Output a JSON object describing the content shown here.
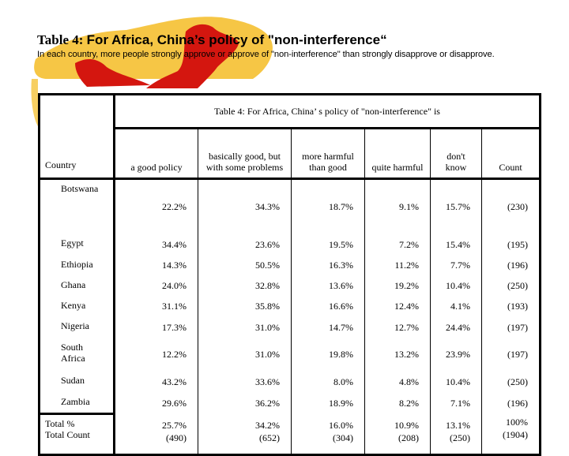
{
  "header": {
    "title_lead": "Table 4: ",
    "title_rest": "For Africa, China’s policy of \"non-interference“",
    "subtitle": "In each country, more people strongly approve or approve of \"non-interference\" than strongly disapprove or disapprove."
  },
  "table": {
    "span_header": "Table 4: For Africa, China’ s policy of \"non-interference\" is",
    "corner_label": "Country",
    "columns": [
      "a good policy",
      "basically good, but with some problems",
      "more harmful than good",
      "quite harmful",
      "don't know",
      "Count"
    ],
    "rows": [
      {
        "country": "Botswana",
        "values": [
          "22.2%",
          "34.3%",
          "18.7%",
          "9.1%",
          "15.7%",
          "(230)"
        ]
      },
      {
        "country": "Egypt",
        "values": [
          "34.4%",
          "23.6%",
          "19.5%",
          "7.2%",
          "15.4%",
          "(195)"
        ]
      },
      {
        "country": "Ethiopia",
        "values": [
          "14.3%",
          "50.5%",
          "16.3%",
          "11.2%",
          "7.7%",
          "(196)"
        ]
      },
      {
        "country": "Ghana",
        "values": [
          "24.0%",
          "32.8%",
          "13.6%",
          "19.2%",
          "10.4%",
          "(250)"
        ]
      },
      {
        "country": "Kenya",
        "values": [
          "31.1%",
          "35.8%",
          "16.6%",
          "12.4%",
          "4.1%",
          "(193)"
        ]
      },
      {
        "country": "Nigeria",
        "values": [
          "17.3%",
          "31.0%",
          "14.7%",
          "12.7%",
          "24.4%",
          "(197)"
        ]
      },
      {
        "country": "South Africa",
        "values": [
          "12.2%",
          "31.0%",
          "19.8%",
          "13.2%",
          "23.9%",
          "(197)"
        ]
      },
      {
        "country": "Sudan",
        "values": [
          "43.2%",
          "33.6%",
          "8.0%",
          "4.8%",
          "10.4%",
          "(250)"
        ]
      },
      {
        "country": "Zambia",
        "values": [
          "29.6%",
          "36.2%",
          "18.9%",
          "8.2%",
          "7.1%",
          "(196)"
        ]
      }
    ],
    "total": {
      "label_pct": "Total %",
      "label_count": "Total Count",
      "pct": [
        "25.7%",
        "34.2%",
        "16.0%",
        "10.9%",
        "13.1%",
        "100%"
      ],
      "count": [
        "(490)",
        "(652)",
        "(304)",
        "(208)",
        "(250)",
        "(1904)"
      ]
    }
  },
  "colors": {
    "map_yellow": "#f5c33b",
    "map_red": "#d4160f",
    "map_green": "#6cc01e"
  }
}
